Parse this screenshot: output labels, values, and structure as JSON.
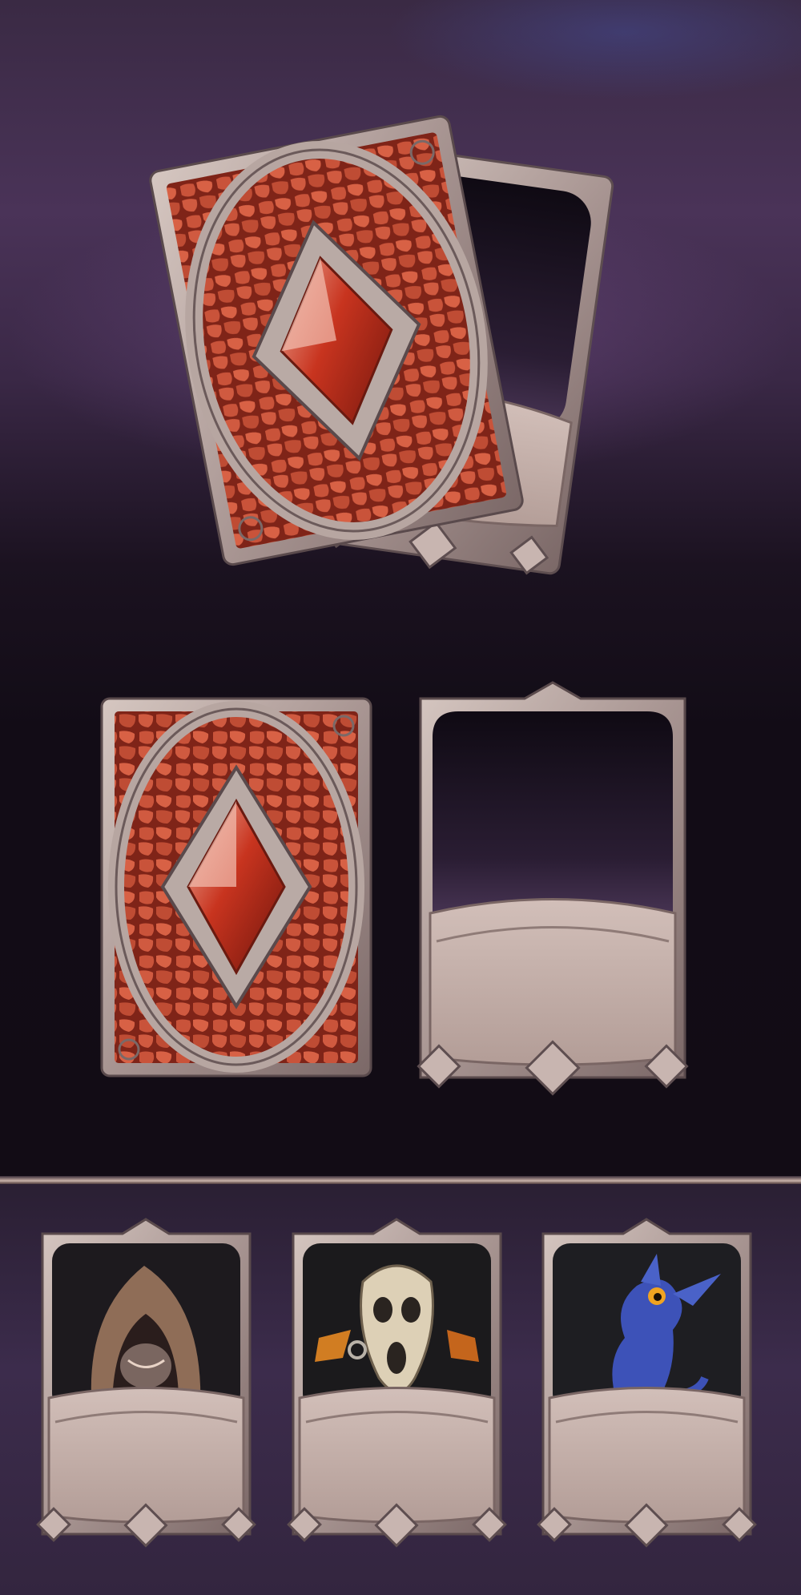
{
  "scene": {
    "showcase": {
      "items": [
        "card-back",
        "card-frame"
      ]
    },
    "flat_cards": {
      "items": [
        "card-back",
        "card-frame"
      ]
    },
    "character_cards": {
      "items": [
        {
          "portrait": "hooded-mage-portrait",
          "icon": "hood-mask-icon"
        },
        {
          "portrait": "skull-mask-shaman-portrait",
          "icon": "skull-mask-icon"
        },
        {
          "portrait": "blue-baby-dragon-portrait",
          "icon": "dragon-icon"
        }
      ]
    }
  },
  "colors": {
    "frame_stone": "#b8a7a2",
    "frame_dark": "#6f5f60",
    "card_back_red": "#b8412a",
    "gem_red": "#c2301c",
    "banner": "#c4afaa",
    "portrait_bg": "#1d1a1e"
  }
}
